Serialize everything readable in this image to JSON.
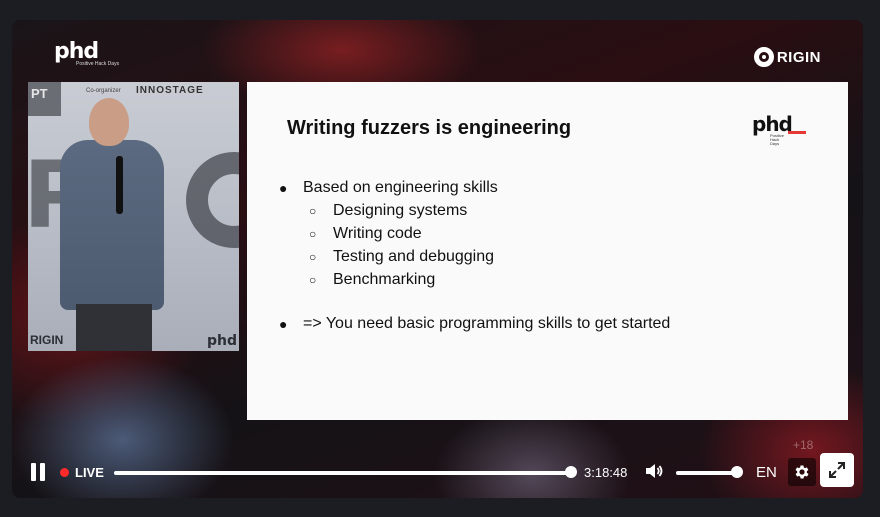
{
  "branding": {
    "phd_mark": "phd",
    "phd_sub": "Positive Hack Days",
    "origin_label": "RIGIN"
  },
  "camera": {
    "pt_label": "PT",
    "coorganizer_label": "Co-organizer",
    "innostage_label": "INNOSTAGE",
    "origin_label": "RIGIN",
    "phd_label": "phd"
  },
  "slide": {
    "title": "Writing fuzzers is engineering",
    "logo_mark": "phd",
    "logo_sub": "Positive Hack Days",
    "bullets": [
      {
        "text": "Based on engineering skills",
        "sub": [
          "Designing systems",
          "Writing code",
          "Testing and debugging",
          "Benchmarking"
        ]
      },
      {
        "text": "=> You need basic programming skills to get started",
        "sub": []
      }
    ]
  },
  "controls": {
    "live_label": "LIVE",
    "time": "3:18:48",
    "language": "EN",
    "settings_badge": "+18",
    "seek_progress": 1.0,
    "volume_level": 1.0,
    "colors": {
      "live_dot": "#ff2a2a",
      "accent": "#ffffff"
    }
  }
}
